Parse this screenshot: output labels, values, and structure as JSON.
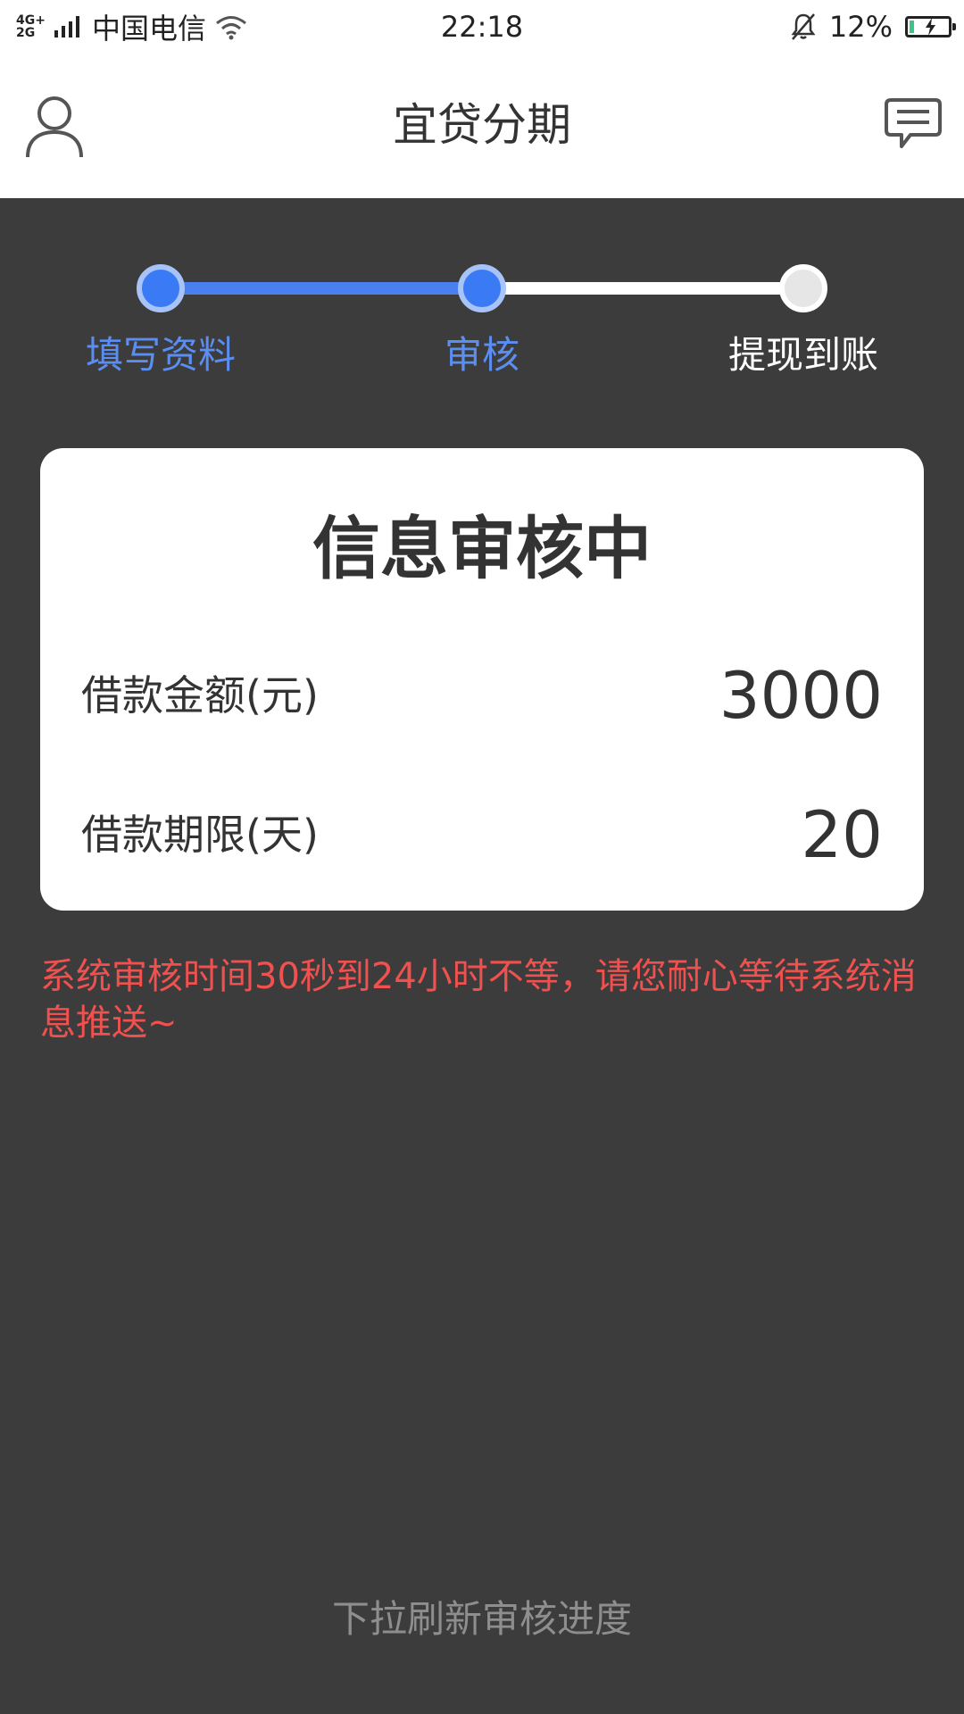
{
  "status_bar": {
    "network_top": "4G+",
    "network_bottom": "2G",
    "carrier": "中国电信",
    "time": "22:18",
    "battery_percent": "12%",
    "battery_level": 0.12
  },
  "header": {
    "title": "宜贷分期",
    "profile_icon": "user-icon",
    "message_icon": "message-icon"
  },
  "steps": [
    {
      "label": "填写资料",
      "state": "done"
    },
    {
      "label": "审核",
      "state": "current"
    },
    {
      "label": "提现到账",
      "state": "pending"
    }
  ],
  "card": {
    "title": "信息审核中",
    "amount_label": "借款金额(元)",
    "amount_value": "3000",
    "term_label": "借款期限(天)",
    "term_value": "20"
  },
  "notice": "系统审核时间30秒到24小时不等，请您耐心等待系统消息推送~",
  "pull_hint": "下拉刷新审核进度",
  "colors": {
    "accent": "#3a7af5",
    "notice": "#f0514f",
    "background": "#3c3c3c"
  }
}
